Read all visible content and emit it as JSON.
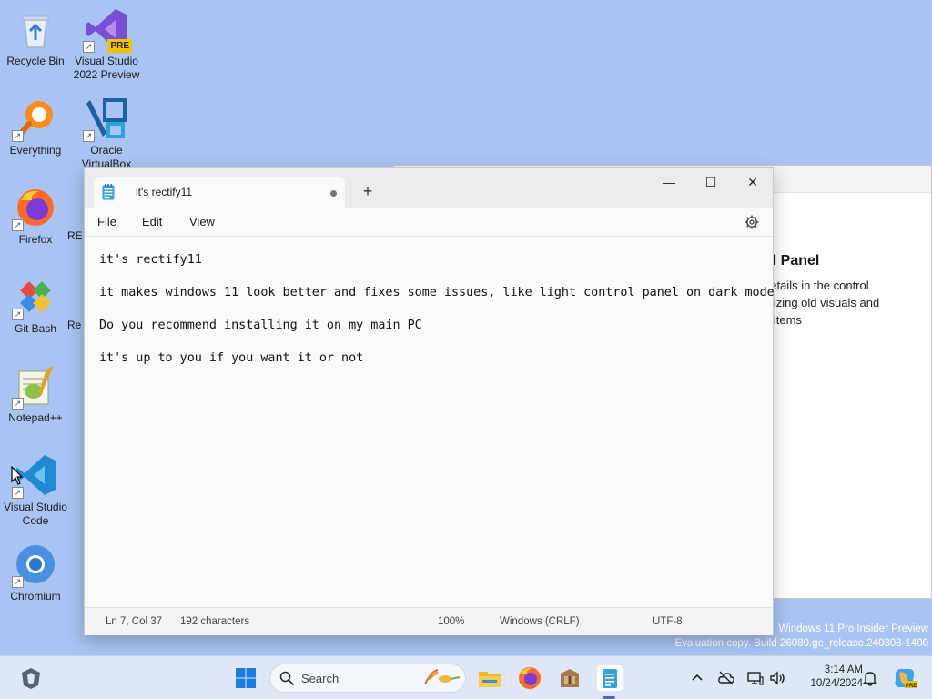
{
  "desktop": {
    "icons": [
      {
        "label": "Recycle Bin",
        "icon": "recycle-bin-icon"
      },
      {
        "label": "Visual Studio 2022 Preview",
        "icon": "visual-studio-preview-icon",
        "badge": "PRE"
      },
      {
        "label": "Everything",
        "icon": "everything-search-icon"
      },
      {
        "label": "Oracle VirtualBox",
        "icon": "virtualbox-icon"
      },
      {
        "label": "Firefox",
        "icon": "firefox-icon"
      },
      {
        "label": "RE",
        "icon": "partial-icon"
      },
      {
        "label": "Git Bash",
        "icon": "git-bash-icon"
      },
      {
        "label": "Re",
        "icon": "partial-icon"
      },
      {
        "label": "Notepad++",
        "icon": "notepadpp-icon"
      },
      {
        "label": "Visual Studio Code",
        "icon": "vscode-icon"
      },
      {
        "label": "Chromium",
        "icon": "chromium-icon"
      }
    ]
  },
  "background_window": {
    "title": "ol Panel",
    "lines": [
      "details in the control",
      "mizing old visuals and",
      "d items"
    ]
  },
  "notepad": {
    "tab_title": "it's rectify11",
    "window_buttons": {
      "minimize": "—",
      "maximize": "☐",
      "close": "✕"
    },
    "menu": {
      "file": "File",
      "edit": "Edit",
      "view": "View"
    },
    "lines": [
      "it's rectify11",
      "it makes windows 11 look better and fixes some issues, like light control panel on dark mode",
      "Do you recommend installing it on my main PC",
      "it's up to you if you want it or not"
    ],
    "status": {
      "position": "Ln 7, Col 37",
      "characters": "192 characters",
      "zoom": "100%",
      "line_ending": "Windows (CRLF)",
      "encoding": "UTF-8"
    }
  },
  "watermark": {
    "line1": "Windows 11 Pro Insider Preview",
    "line2": "Evaluation copy. Build 26080.ge_release.240308-1400"
  },
  "taskbar": {
    "search_placeholder": "Search",
    "time": "3:14 AM",
    "date": "10/24/2024",
    "pinned": [
      "file-explorer-icon",
      "firefox-icon",
      "archive-app-icon",
      "notepad-icon"
    ],
    "accent": "#3a6fd0"
  }
}
